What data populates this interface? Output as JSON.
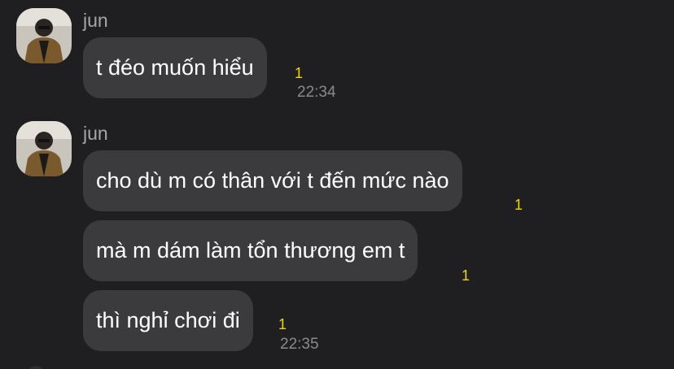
{
  "groups": [
    {
      "sender": "jun",
      "avatar_icon": "avatar-photo-icon",
      "messages": [
        {
          "text": "t đéo muốn hiểu",
          "unread": "1",
          "time": "22:34"
        }
      ]
    },
    {
      "sender": "jun",
      "avatar_icon": "avatar-photo-icon",
      "messages": [
        {
          "text": "cho dù m có thân với t đến mức nào",
          "unread": "1",
          "time": ""
        },
        {
          "text": "mà m dám làm tổn thương em t",
          "unread": "1",
          "time": ""
        },
        {
          "text": "thì nghỉ chơi đi",
          "unread": "1",
          "time": "22:35"
        }
      ]
    }
  ],
  "colors": {
    "background": "#1f1f21",
    "bubble": "#3b3b3e",
    "unread": "#f2d600",
    "text": "#ffffff",
    "meta": "#8a8a8e"
  }
}
